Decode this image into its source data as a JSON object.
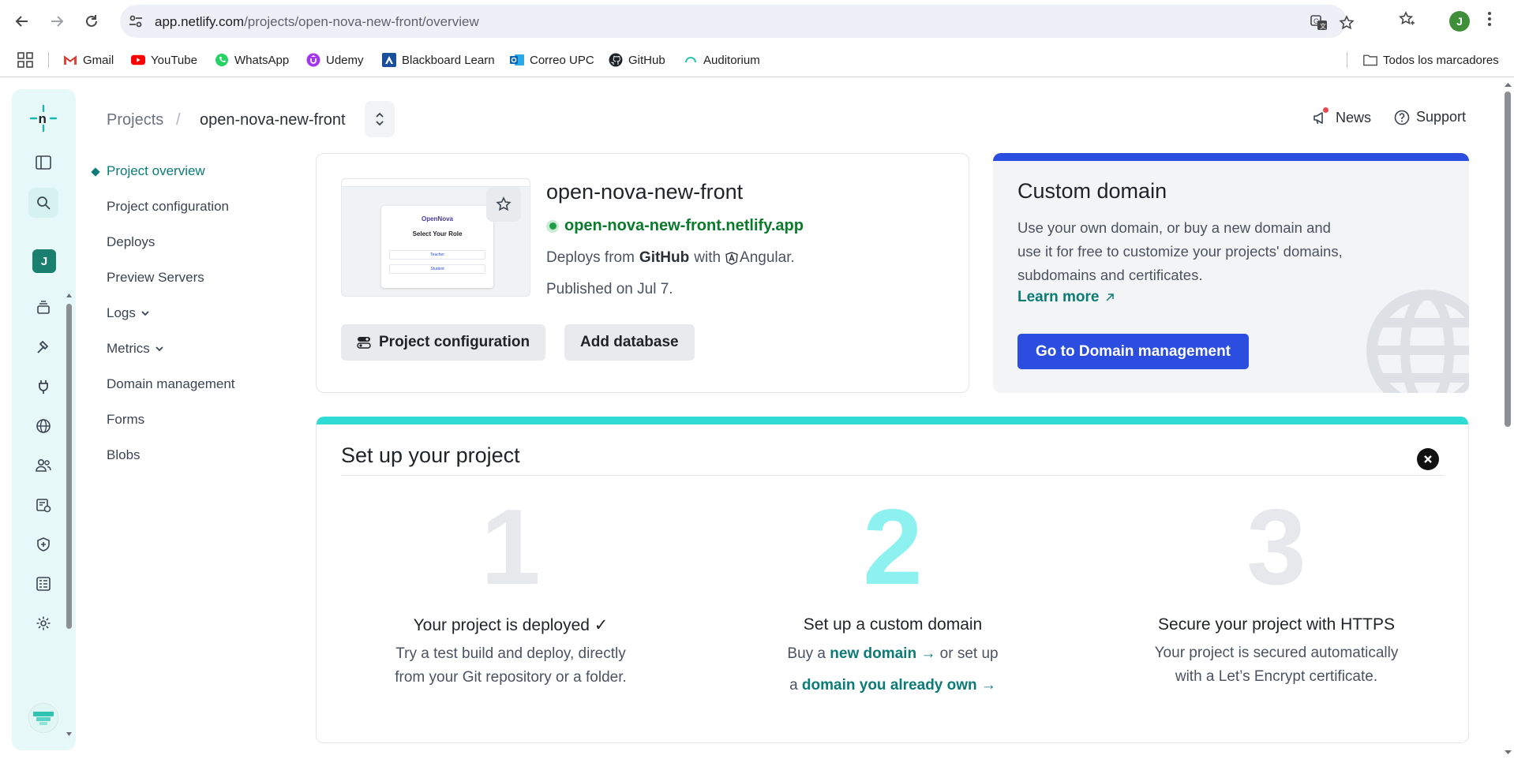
{
  "browser": {
    "url_host": "app.netlify.com",
    "url_path": "/projects/open-nova-new-front/overview",
    "profile_initial": "J"
  },
  "bookmarks": {
    "items": [
      {
        "label": "Gmail",
        "icon": "gmail-icon"
      },
      {
        "label": "YouTube",
        "icon": "youtube-icon"
      },
      {
        "label": "WhatsApp",
        "icon": "whatsapp-icon"
      },
      {
        "label": "Udemy",
        "icon": "udemy-icon"
      },
      {
        "label": "Blackboard Learn",
        "icon": "blackboard-icon"
      },
      {
        "label": "Correo UPC",
        "icon": "outlook-icon"
      },
      {
        "label": "GitHub",
        "icon": "github-icon"
      },
      {
        "label": "Auditorium",
        "icon": "auditorium-icon"
      }
    ],
    "all_bookmarks_label": "Todos los marcadores"
  },
  "rail": {
    "team_initial": "J",
    "icons": [
      "layers-icon",
      "hammer-icon",
      "plug-icon",
      "globe-icon",
      "users-icon",
      "form-icon",
      "shield-icon",
      "log-icon",
      "gear-icon"
    ]
  },
  "header": {
    "breadcrumb_projects": "Projects",
    "breadcrumb_separator": "/",
    "breadcrumb_project": "open-nova-new-front",
    "news_label": "News",
    "support_label": "Support"
  },
  "subnav": {
    "items": [
      {
        "label": "Project overview",
        "active": true
      },
      {
        "label": "Project configuration"
      },
      {
        "label": "Deploys"
      },
      {
        "label": "Preview Servers"
      },
      {
        "label": "Logs",
        "has_caret": true
      },
      {
        "label": "Metrics",
        "has_caret": true
      },
      {
        "label": "Domain management"
      },
      {
        "label": "Forms"
      },
      {
        "label": "Blobs"
      }
    ]
  },
  "project": {
    "name": "open-nova-new-front",
    "site_url": "open-nova-new-front.netlify.app",
    "deploys_prefix": "Deploys from",
    "deploys_source": "GitHub",
    "deploys_with": "with",
    "framework": "Angular.",
    "published": "Published on Jul 7.",
    "config_button": "Project configuration",
    "database_button": "Add database",
    "thumbnail": {
      "app_name": "OpenNova",
      "heading": "Select Your Role",
      "option1": "Teacher",
      "option2": "Student"
    }
  },
  "domain_card": {
    "title": "Custom domain",
    "text": "Use your own domain, or buy a new domain and use it for free to customize your projects' domains, subdomains and certificates.",
    "learn_more": "Learn more",
    "button": "Go to Domain management",
    "accent_color": "#2b4de0"
  },
  "setup": {
    "title": "Set up your project",
    "accent_color": "#2fdcd4",
    "steps": [
      {
        "number": "1",
        "title": "Your project is deployed ✓",
        "line1": "Try a test build and deploy, directly",
        "line2": "from your Git repository or a folder."
      },
      {
        "number": "2",
        "title": "Set up a custom domain",
        "p1": "Buy a",
        "link1": "new domain →",
        "p2": " or set up",
        "p3": "a",
        "link2": "domain you already own →"
      },
      {
        "number": "3",
        "title": "Secure your project with HTTPS",
        "line1": "Your project is secured automatically",
        "line2": "with a Let’s Encrypt certificate."
      }
    ]
  }
}
